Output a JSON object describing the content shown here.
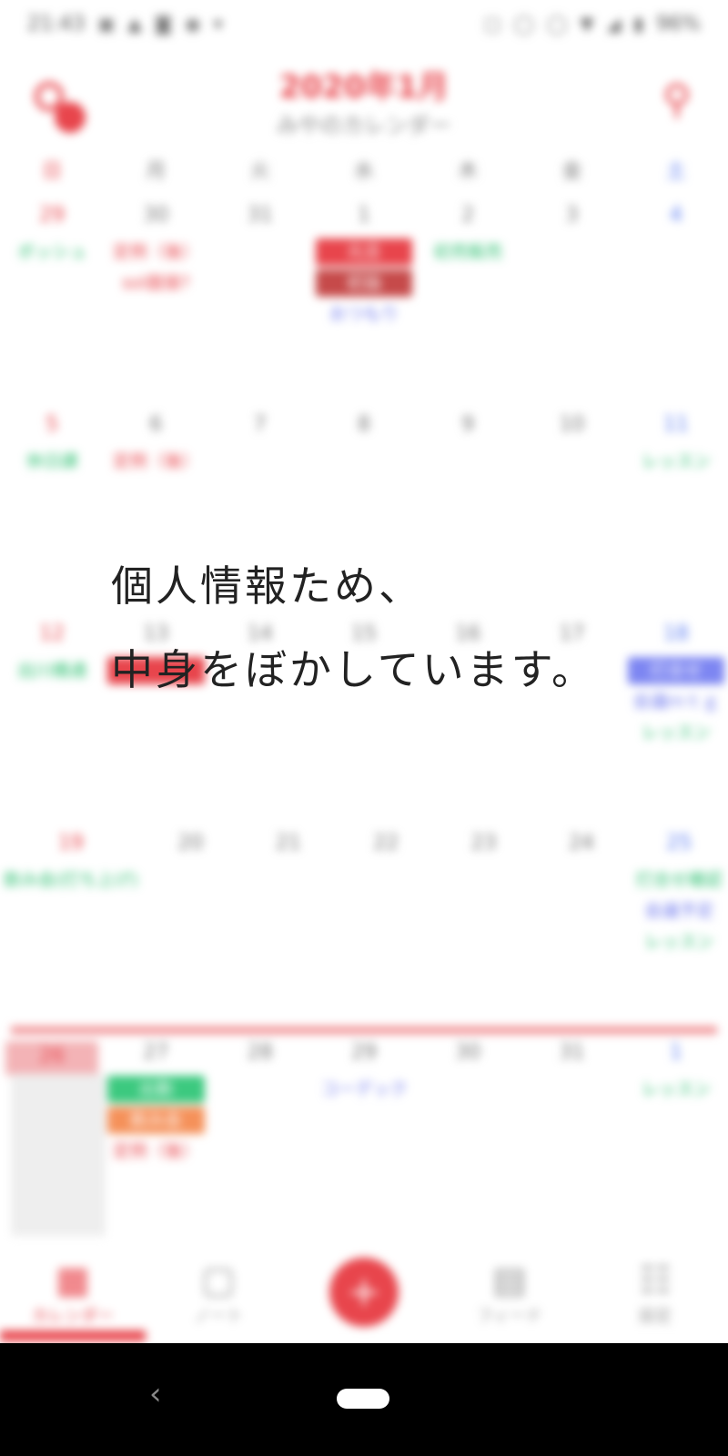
{
  "status_bar": {
    "time": "21:43",
    "battery": "96%",
    "left_icons": [
      "image-icon",
      "mountain-icon",
      "nfc-icon",
      "location-icon",
      "expand-icon"
    ],
    "right_icons": [
      "sync-icon",
      "circle-icon",
      "circle-icon",
      "wifi-icon",
      "signal-icon",
      "battery-icon"
    ]
  },
  "header": {
    "title": "2020年1月",
    "subtitle": "みやのカレンダー"
  },
  "weekdays": [
    "日",
    "月",
    "火",
    "水",
    "木",
    "金",
    "土"
  ],
  "weeks": [
    {
      "days": [
        {
          "num": "29",
          "events": [
            {
              "text": "ボッシュ",
              "style": "green"
            }
          ]
        },
        {
          "num": "30",
          "events": [
            {
              "text": "定例（後）",
              "style": "red"
            },
            {
              "text": "sol面接?",
              "style": "red"
            }
          ]
        },
        {
          "num": "31",
          "events": []
        },
        {
          "num": "1",
          "events": [
            {
              "text": "元旦",
              "style": "red-fill"
            },
            {
              "text": "初詣",
              "style": "darkred-fill"
            },
            {
              "text": "おつもり",
              "style": "blue"
            }
          ]
        },
        {
          "num": "2",
          "events": [
            {
              "text": "初売販売",
              "style": "green"
            }
          ]
        },
        {
          "num": "3",
          "events": []
        },
        {
          "num": "4",
          "events": []
        }
      ]
    },
    {
      "days": [
        {
          "num": "5",
          "events": [
            {
              "text": "休日課",
              "style": "green"
            }
          ]
        },
        {
          "num": "6",
          "events": [
            {
              "text": "定例（後）",
              "style": "red"
            }
          ]
        },
        {
          "num": "7",
          "events": []
        },
        {
          "num": "8",
          "events": []
        },
        {
          "num": "9",
          "events": []
        },
        {
          "num": "10",
          "events": []
        },
        {
          "num": "11",
          "events": [
            {
              "text": "レッスン",
              "style": "green"
            }
          ]
        }
      ]
    },
    {
      "days": [
        {
          "num": "12",
          "events": [
            {
              "text": "出川橋通",
              "style": "green"
            }
          ]
        },
        {
          "num": "13",
          "events": [
            {
              "text": "",
              "style": "red-fill"
            }
          ]
        },
        {
          "num": "14",
          "events": []
        },
        {
          "num": "15",
          "events": []
        },
        {
          "num": "16",
          "events": []
        },
        {
          "num": "17",
          "events": []
        },
        {
          "num": "18",
          "events": [
            {
              "text": "打合せ",
              "style": "blue-fill"
            },
            {
              "text": "会議ｍｔｇ",
              "style": "blue"
            },
            {
              "text": "レッスン",
              "style": "green"
            }
          ]
        }
      ]
    },
    {
      "days": [
        {
          "num": "19",
          "events": [
            {
              "text": "飲み会(打ち上げ)",
              "style": "green"
            }
          ]
        },
        {
          "num": "20",
          "events": []
        },
        {
          "num": "21",
          "events": []
        },
        {
          "num": "22",
          "events": []
        },
        {
          "num": "23",
          "events": []
        },
        {
          "num": "24",
          "events": []
        },
        {
          "num": "25",
          "events": [
            {
              "text": "打合せ確認",
              "style": "green"
            },
            {
              "text": "会議予定",
              "style": "blue"
            },
            {
              "text": "レッスン",
              "style": "green"
            }
          ]
        }
      ]
    },
    {
      "days": [
        {
          "num": "26",
          "events": []
        },
        {
          "num": "27",
          "events": [
            {
              "text": "出勤",
              "style": "green-fill"
            },
            {
              "text": "飲み会",
              "style": "orange-fill"
            },
            {
              "text": "定例（後）",
              "style": "red"
            }
          ]
        },
        {
          "num": "28",
          "events": []
        },
        {
          "num": "29",
          "events": [
            {
              "text": "コーデック",
              "style": "blue"
            }
          ]
        },
        {
          "num": "30",
          "events": []
        },
        {
          "num": "31",
          "events": []
        },
        {
          "num": "1",
          "events": [
            {
              "text": "レッスン",
              "style": "green"
            }
          ]
        }
      ]
    }
  ],
  "bottom_nav": {
    "items": [
      {
        "label": "カレンダー",
        "icon": "calendar-icon",
        "active": true
      },
      {
        "label": "ノート",
        "icon": "note-icon",
        "active": false
      },
      {
        "label": "+",
        "icon": "plus-icon",
        "fab": true
      },
      {
        "label": "フィード",
        "icon": "feed-icon",
        "active": false
      },
      {
        "label": "設定",
        "icon": "settings-icon",
        "active": false
      }
    ]
  },
  "overlay": {
    "line1": "個人情報ため、",
    "line2": "中身をぼかしています。"
  },
  "colors": {
    "accent": "#e8454c",
    "green": "#2bbf6f",
    "blue": "#6f79ee",
    "orange": "#f5915a"
  }
}
